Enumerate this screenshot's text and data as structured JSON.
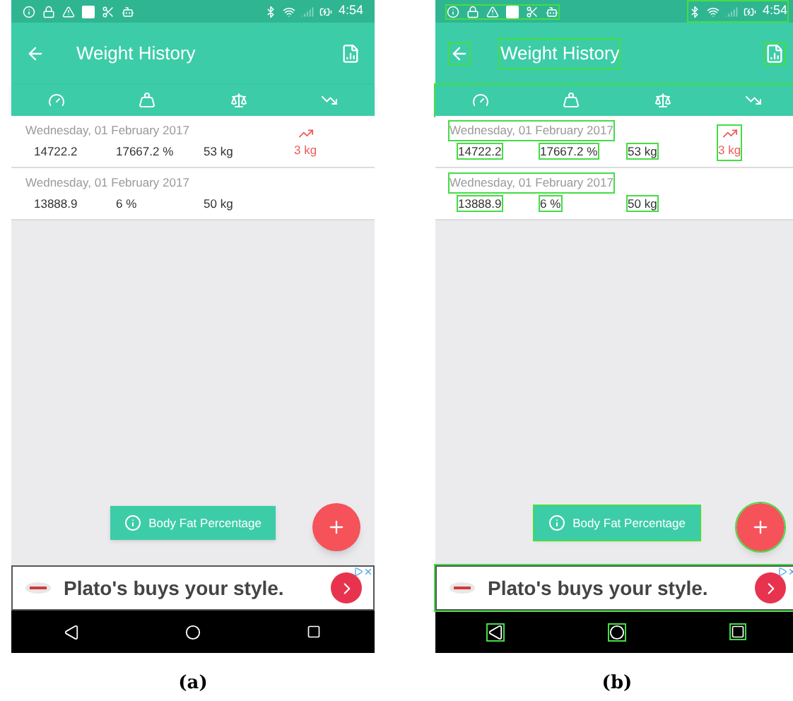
{
  "panels": [
    {
      "caption": "(a)",
      "annotated": false,
      "status_bar": {
        "time": "4:54"
      },
      "app_bar": {
        "title": "Weight History"
      },
      "entries": [
        {
          "date": "Wednesday, 01 February 2017",
          "values": [
            "14722.2",
            "17667.2 %",
            "53 kg"
          ],
          "change": "3 kg",
          "rising": true
        },
        {
          "date": "Wednesday, 01 February 2017",
          "values": [
            "13888.9",
            "6 %",
            "50 kg"
          ],
          "rising": false
        }
      ],
      "chip": "Body Fat Percentage",
      "ad": {
        "text": "Plato's buys your style."
      }
    },
    {
      "caption": "(b)",
      "annotated": true,
      "status_bar": {
        "time": "4:54"
      },
      "app_bar": {
        "title": "Weight History"
      },
      "entries": [
        {
          "date": "Wednesday, 01 February 2017",
          "values": [
            "14722.2",
            "17667.2 %",
            "53 kg"
          ],
          "change": "3 kg",
          "rising": true
        },
        {
          "date": "Wednesday, 01 February 2017",
          "values": [
            "13888.9",
            "6 %",
            "50 kg"
          ],
          "rising": false
        }
      ],
      "chip": "Body Fat Percentage",
      "ad": {
        "text": "Plato's buys your style."
      }
    }
  ]
}
